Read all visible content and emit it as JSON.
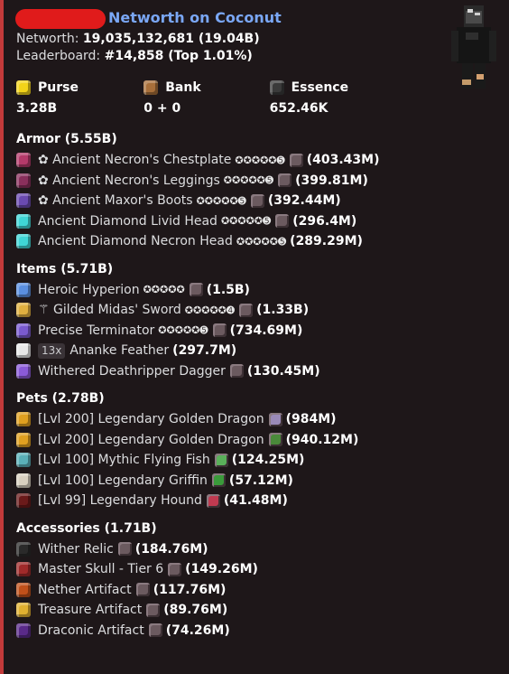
{
  "header": {
    "title": "Networth on Coconut"
  },
  "summary": {
    "networth_label": "Networth:",
    "networth_value": "19,035,132,681 (19.04B)",
    "leaderboard_label": "Leaderboard:",
    "leaderboard_value": "#14,858 (Top 1.01%)"
  },
  "stats": [
    {
      "label": "Purse",
      "value": "3.28B",
      "icon": "gold-ingot-icon",
      "color": "#f2d31a"
    },
    {
      "label": "Bank",
      "value": "0 + 0",
      "icon": "chest-icon",
      "color": "#a86f3a"
    },
    {
      "label": "Essence",
      "value": "652.46K",
      "icon": "wither-essence-icon",
      "color": "#3a3a3a"
    }
  ],
  "sections": {
    "armor": {
      "title": "Armor (5.55B)",
      "items": [
        {
          "name": "✿ Ancient Necron's Chestplate",
          "stars": "✪✪✪✪✪➎",
          "gem": true,
          "value": "(403.43M)",
          "icon": "necron-chestplate-icon",
          "color": "#b43a6a"
        },
        {
          "name": "✿ Ancient Necron's Leggings",
          "stars": "✪✪✪✪✪➎",
          "gem": true,
          "value": "(399.81M)",
          "icon": "necron-leggings-icon",
          "color": "#8a2f5c"
        },
        {
          "name": "✿ Ancient Maxor's Boots",
          "stars": "✪✪✪✪✪➎",
          "gem": true,
          "value": "(392.44M)",
          "icon": "maxor-boots-icon",
          "color": "#6a4ab0"
        },
        {
          "name": "Ancient Diamond Livid Head",
          "stars": "✪✪✪✪✪➎",
          "gem": true,
          "value": "(296.4M)",
          "icon": "diamond-head-icon",
          "color": "#3fd6d6"
        },
        {
          "name": "Ancient Diamond Necron Head",
          "stars": "✪✪✪✪✪➎",
          "gem": false,
          "value": "(289.29M)",
          "icon": "diamond-head-icon",
          "color": "#3fd6d6"
        }
      ]
    },
    "items": {
      "title": "Items (5.71B)",
      "items": [
        {
          "count": "",
          "name": "Heroic Hyperion",
          "stars": "✪✪✪✪✪",
          "gem": true,
          "value": "(1.5B)",
          "icon": "hyperion-sword-icon",
          "color": "#5a8fe0"
        },
        {
          "count": "",
          "name": "⚚ Gilded Midas' Sword",
          "stars": "✪✪✪✪✪➍",
          "gem": true,
          "value": "(1.33B)",
          "icon": "midas-sword-icon",
          "color": "#e0b040"
        },
        {
          "count": "",
          "name": "Precise Terminator",
          "stars": "✪✪✪✪✪➎",
          "gem": true,
          "value": "(734.69M)",
          "icon": "terminator-bow-icon",
          "color": "#7a5ad0"
        },
        {
          "count": "13x",
          "name": "Ananke Feather",
          "stars": "",
          "gem": false,
          "value": "(297.7M)",
          "icon": "feather-icon",
          "color": "#e8e8e8"
        },
        {
          "count": "",
          "name": "Withered Deathripper Dagger",
          "stars": "",
          "gem": true,
          "value": "(130.45M)",
          "icon": "dagger-icon",
          "color": "#8a5ad8"
        }
      ]
    },
    "pets": {
      "title": "Pets (2.78B)",
      "items": [
        {
          "name": "[Lvl 200] Legendary Golden Dragon",
          "pet_item_icon": "pet-item-icon",
          "pet_item_color": "#9a8ab8",
          "value": "(984M)",
          "icon": "golden-dragon-icon",
          "color": "#e0a020"
        },
        {
          "name": "[Lvl 200] Legendary Golden Dragon",
          "pet_item_icon": "pet-item-icon",
          "pet_item_color": "#4a8a3a",
          "value": "(940.12M)",
          "icon": "golden-dragon-icon",
          "color": "#e0a020"
        },
        {
          "name": "[Lvl 100] Mythic Flying Fish",
          "pet_item_icon": "pet-item-icon",
          "pet_item_color": "#5ab05a",
          "value": "(124.25M)",
          "icon": "flying-fish-icon",
          "color": "#5ab0b8"
        },
        {
          "name": "[Lvl 100] Legendary Griffin",
          "pet_item_icon": "pet-item-icon",
          "pet_item_color": "#3a9a3a",
          "value": "(57.12M)",
          "icon": "griffin-icon",
          "color": "#d8d0c0"
        },
        {
          "name": "[Lvl 99] Legendary Hound",
          "pet_item_icon": "pet-item-icon",
          "pet_item_color": "#c03a50",
          "value": "(41.48M)",
          "icon": "hound-icon",
          "color": "#6a1a1a"
        }
      ]
    },
    "accessories": {
      "title": "Accessories (1.71B)",
      "items": [
        {
          "name": "Wither Relic",
          "gem": true,
          "value": "(184.76M)",
          "icon": "wither-relic-icon",
          "color": "#2a2a2a"
        },
        {
          "name": "Master Skull - Tier 6",
          "gem": true,
          "value": "(149.26M)",
          "icon": "master-skull-icon",
          "color": "#a02a2a"
        },
        {
          "name": "Nether Artifact",
          "gem": true,
          "value": "(117.76M)",
          "icon": "nether-artifact-icon",
          "color": "#c0501a"
        },
        {
          "name": "Treasure Artifact",
          "gem": true,
          "value": "(89.76M)",
          "icon": "treasure-artifact-icon",
          "color": "#e0b030"
        },
        {
          "name": "Draconic Artifact",
          "gem": true,
          "value": "(74.26M)",
          "icon": "draconic-artifact-icon",
          "color": "#5a2a8a"
        }
      ]
    }
  }
}
